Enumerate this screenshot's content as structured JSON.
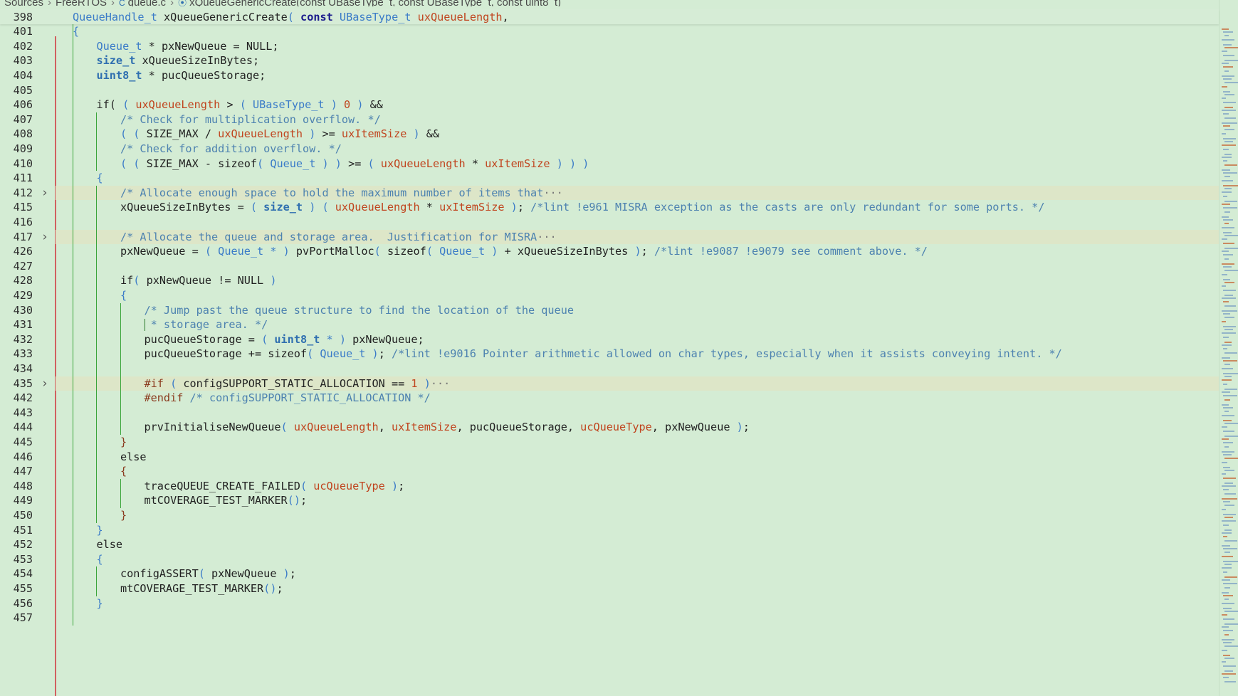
{
  "breadcrumb": {
    "items": [
      "Sources",
      "FreeRTOS",
      "queue.c",
      "xQueueGenericCreate(const UBaseType_t, const UBaseType_t, const uint8_t)"
    ],
    "file_icon": "c-file-icon",
    "symbol_icon": "function-symbol-icon"
  },
  "editor": {
    "sticky_line": {
      "number": "398",
      "tokens": [
        {
          "t": "QueueHandle_t",
          "c": "ty"
        },
        {
          "t": " xQueueGenericCreate",
          "c": ""
        },
        {
          "t": "( ",
          "c": "br"
        },
        {
          "t": "const",
          "c": "kw"
        },
        {
          "t": " ",
          "c": ""
        },
        {
          "t": "UBaseType_t",
          "c": "ty"
        },
        {
          "t": " ",
          "c": ""
        },
        {
          "t": "uxQueueLength",
          "c": "pm"
        },
        {
          "t": ",",
          "c": ""
        }
      ]
    },
    "lines": [
      {
        "n": "401",
        "tokens": [
          {
            "t": "{",
            "c": "br"
          }
        ],
        "indent": 0
      },
      {
        "n": "402",
        "tokens": [
          {
            "t": "Queue_t",
            "c": "ty"
          },
          {
            "t": " * pxNewQueue = NULL;",
            "c": ""
          }
        ],
        "indent": 1
      },
      {
        "n": "403",
        "tokens": [
          {
            "t": "size_t",
            "c": "tyb"
          },
          {
            "t": " xQueueSizeInBytes;",
            "c": ""
          }
        ],
        "indent": 1
      },
      {
        "n": "404",
        "tokens": [
          {
            "t": "uint8_t",
            "c": "tyb"
          },
          {
            "t": " * pucQueueStorage;",
            "c": ""
          }
        ],
        "indent": 1
      },
      {
        "n": "405",
        "tokens": [],
        "indent": 1
      },
      {
        "n": "406",
        "tokens": [
          {
            "t": "if( ",
            "c": ""
          },
          {
            "t": "( ",
            "c": "br"
          },
          {
            "t": "uxQueueLength",
            "c": "pm"
          },
          {
            "t": " > ",
            "c": ""
          },
          {
            "t": "( ",
            "c": "br"
          },
          {
            "t": "UBaseType_t",
            "c": "ty"
          },
          {
            "t": " ) ",
            "c": "br"
          },
          {
            "t": "0",
            "c": "num"
          },
          {
            "t": " ) ",
            "c": "br"
          },
          {
            "t": "&&",
            "c": ""
          }
        ],
        "indent": 1
      },
      {
        "n": "407",
        "tokens": [
          {
            "t": "/* Check for multiplication overflow. */",
            "c": "cm"
          }
        ],
        "indent": 2
      },
      {
        "n": "408",
        "tokens": [
          {
            "t": "( ( ",
            "c": "br"
          },
          {
            "t": "SIZE_MAX / ",
            "c": ""
          },
          {
            "t": "uxQueueLength",
            "c": "pm"
          },
          {
            "t": " ) ",
            "c": "br"
          },
          {
            "t": ">= ",
            "c": ""
          },
          {
            "t": "uxItemSize",
            "c": "pm"
          },
          {
            "t": " ) ",
            "c": "br"
          },
          {
            "t": "&&",
            "c": ""
          }
        ],
        "indent": 2
      },
      {
        "n": "409",
        "tokens": [
          {
            "t": "/* Check for addition overflow. */",
            "c": "cm"
          }
        ],
        "indent": 2
      },
      {
        "n": "410",
        "tokens": [
          {
            "t": "( ( ",
            "c": "br"
          },
          {
            "t": "SIZE_MAX - sizeof",
            "c": ""
          },
          {
            "t": "( ",
            "c": "br"
          },
          {
            "t": "Queue_t",
            "c": "ty"
          },
          {
            "t": " ) ) ",
            "c": "br"
          },
          {
            "t": ">= ",
            "c": ""
          },
          {
            "t": "( ",
            "c": "br"
          },
          {
            "t": "uxQueueLength",
            "c": "pm"
          },
          {
            "t": " * ",
            "c": ""
          },
          {
            "t": "uxItemSize",
            "c": "pm"
          },
          {
            "t": " ) ) )",
            "c": "br"
          }
        ],
        "indent": 2
      },
      {
        "n": "411",
        "tokens": [
          {
            "t": "{",
            "c": "br"
          }
        ],
        "indent": 1
      },
      {
        "n": "412",
        "tokens": [
          {
            "t": "/* Allocate enough space to hold the maximum number of items that",
            "c": "cm"
          },
          {
            "t": "···",
            "c": "ellipsis"
          }
        ],
        "indent": 2,
        "folded": true
      },
      {
        "n": "415",
        "tokens": [
          {
            "t": "xQueueSizeInBytes = ",
            "c": ""
          },
          {
            "t": "( ",
            "c": "br"
          },
          {
            "t": "size_t",
            "c": "tyb"
          },
          {
            "t": " ) ( ",
            "c": "br"
          },
          {
            "t": "uxQueueLength",
            "c": "pm"
          },
          {
            "t": " * ",
            "c": ""
          },
          {
            "t": "uxItemSize",
            "c": "pm"
          },
          {
            "t": " )",
            "c": "br"
          },
          {
            "t": "; ",
            "c": ""
          },
          {
            "t": "/*lint !e961 MISRA exception as the casts are only redundant for some ports. */",
            "c": "cm"
          }
        ],
        "indent": 2
      },
      {
        "n": "416",
        "tokens": [],
        "indent": 2
      },
      {
        "n": "417",
        "tokens": [
          {
            "t": "/* Allocate the queue and storage area.  Justification for MISRA",
            "c": "cm"
          },
          {
            "t": "···",
            "c": "ellipsis"
          }
        ],
        "indent": 2,
        "folded": true
      },
      {
        "n": "426",
        "tokens": [
          {
            "t": "pxNewQueue = ",
            "c": ""
          },
          {
            "t": "( ",
            "c": "br"
          },
          {
            "t": "Queue_t",
            "c": "ty"
          },
          {
            "t": " * ) ",
            "c": "br"
          },
          {
            "t": "pvPortMalloc",
            "c": ""
          },
          {
            "t": "( ",
            "c": "br"
          },
          {
            "t": "sizeof",
            "c": ""
          },
          {
            "t": "( ",
            "c": "br"
          },
          {
            "t": "Queue_t",
            "c": "ty"
          },
          {
            "t": " ) ",
            "c": "br"
          },
          {
            "t": "+ xQueueSizeInBytes ",
            "c": ""
          },
          {
            "t": ")",
            "c": "br"
          },
          {
            "t": "; ",
            "c": ""
          },
          {
            "t": "/*lint !e9087 !e9079 see comment above. */",
            "c": "cm"
          }
        ],
        "indent": 2
      },
      {
        "n": "427",
        "tokens": [],
        "indent": 2
      },
      {
        "n": "428",
        "tokens": [
          {
            "t": "if",
            "c": ""
          },
          {
            "t": "( ",
            "c": "br"
          },
          {
            "t": "pxNewQueue != NULL ",
            "c": ""
          },
          {
            "t": ")",
            "c": "br"
          }
        ],
        "indent": 2
      },
      {
        "n": "429",
        "tokens": [
          {
            "t": "{",
            "c": "br"
          }
        ],
        "indent": 2
      },
      {
        "n": "430",
        "tokens": [
          {
            "t": "/* Jump past the queue structure to find the location of the queue",
            "c": "cm"
          }
        ],
        "indent": 3
      },
      {
        "n": "431",
        "tokens": [
          {
            "t": " * storage area. */",
            "c": "cm"
          }
        ],
        "indent": 3,
        "comment_guide": true
      },
      {
        "n": "432",
        "tokens": [
          {
            "t": "pucQueueStorage = ",
            "c": ""
          },
          {
            "t": "( ",
            "c": "br"
          },
          {
            "t": "uint8_t",
            "c": "tyb"
          },
          {
            "t": " * ) ",
            "c": "br"
          },
          {
            "t": "pxNewQueue;",
            "c": ""
          }
        ],
        "indent": 3
      },
      {
        "n": "433",
        "tokens": [
          {
            "t": "pucQueueStorage += sizeof",
            "c": ""
          },
          {
            "t": "( ",
            "c": "br"
          },
          {
            "t": "Queue_t",
            "c": "ty"
          },
          {
            "t": " )",
            "c": "br"
          },
          {
            "t": "; ",
            "c": ""
          },
          {
            "t": "/*lint !e9016 Pointer arithmetic allowed on char types, especially when it assists conveying intent. */",
            "c": "cm"
          }
        ],
        "indent": 3
      },
      {
        "n": "434",
        "tokens": [],
        "indent": 3
      },
      {
        "n": "435",
        "tokens": [
          {
            "t": "#if ",
            "c": "pp"
          },
          {
            "t": "( ",
            "c": "br"
          },
          {
            "t": "configSUPPORT_STATIC_ALLOCATION == ",
            "c": ""
          },
          {
            "t": "1",
            "c": "num"
          },
          {
            "t": " )",
            "c": "br"
          },
          {
            "t": "···",
            "c": "ellipsis"
          }
        ],
        "indent": 3,
        "folded": true
      },
      {
        "n": "442",
        "tokens": [
          {
            "t": "#endif ",
            "c": "pp"
          },
          {
            "t": "/* configSUPPORT_STATIC_ALLOCATION */",
            "c": "cm"
          }
        ],
        "indent": 3
      },
      {
        "n": "443",
        "tokens": [],
        "indent": 3
      },
      {
        "n": "444",
        "tokens": [
          {
            "t": "prvInitialiseNewQueue",
            "c": ""
          },
          {
            "t": "( ",
            "c": "br"
          },
          {
            "t": "uxQueueLength",
            "c": "pm"
          },
          {
            "t": ", ",
            "c": ""
          },
          {
            "t": "uxItemSize",
            "c": "pm"
          },
          {
            "t": ", pucQueueStorage, ",
            "c": ""
          },
          {
            "t": "ucQueueType",
            "c": "pm"
          },
          {
            "t": ", pxNewQueue ",
            "c": ""
          },
          {
            "t": ")",
            "c": "br"
          },
          {
            "t": ";",
            "c": ""
          }
        ],
        "indent": 3
      },
      {
        "n": "445",
        "tokens": [
          {
            "t": "}",
            "c": "pp"
          }
        ],
        "indent": 2
      },
      {
        "n": "446",
        "tokens": [
          {
            "t": "else",
            "c": ""
          }
        ],
        "indent": 2
      },
      {
        "n": "447",
        "tokens": [
          {
            "t": "{",
            "c": "pp"
          }
        ],
        "indent": 2
      },
      {
        "n": "448",
        "tokens": [
          {
            "t": "traceQUEUE_CREATE_FAILED",
            "c": ""
          },
          {
            "t": "( ",
            "c": "br"
          },
          {
            "t": "ucQueueType",
            "c": "pm"
          },
          {
            "t": " )",
            "c": "br"
          },
          {
            "t": ";",
            "c": ""
          }
        ],
        "indent": 3
      },
      {
        "n": "449",
        "tokens": [
          {
            "t": "mtCOVERAGE_TEST_MARKER",
            "c": ""
          },
          {
            "t": "()",
            "c": "br"
          },
          {
            "t": ";",
            "c": ""
          }
        ],
        "indent": 3
      },
      {
        "n": "450",
        "tokens": [
          {
            "t": "}",
            "c": "pp"
          }
        ],
        "indent": 2
      },
      {
        "n": "451",
        "tokens": [
          {
            "t": "}",
            "c": "br"
          }
        ],
        "indent": 1
      },
      {
        "n": "452",
        "tokens": [
          {
            "t": "else",
            "c": ""
          }
        ],
        "indent": 1
      },
      {
        "n": "453",
        "tokens": [
          {
            "t": "{",
            "c": "br"
          }
        ],
        "indent": 1
      },
      {
        "n": "454",
        "tokens": [
          {
            "t": "configASSERT",
            "c": ""
          },
          {
            "t": "( ",
            "c": "br"
          },
          {
            "t": "pxNewQueue ",
            "c": ""
          },
          {
            "t": ")",
            "c": "br"
          },
          {
            "t": ";",
            "c": ""
          }
        ],
        "indent": 2
      },
      {
        "n": "455",
        "tokens": [
          {
            "t": "mtCOVERAGE_TEST_MARKER",
            "c": ""
          },
          {
            "t": "()",
            "c": "br"
          },
          {
            "t": ";",
            "c": ""
          }
        ],
        "indent": 2
      },
      {
        "n": "456",
        "tokens": [
          {
            "t": "}",
            "c": "br"
          }
        ],
        "indent": 1
      },
      {
        "n": "457",
        "tokens": [],
        "indent": 1
      }
    ]
  },
  "colors": {
    "background": "#d4ecd4",
    "keyword": "#1a1a8c",
    "type": "#3a7bc8",
    "parameter": "#c0441e",
    "comment": "#4d82b0",
    "folded_highlight": "#dde6c8",
    "indent_guide": "#3aa53a",
    "modified_gutter": "#d06060"
  },
  "icons": {
    "fold_collapsed": "chevron-right-icon"
  }
}
